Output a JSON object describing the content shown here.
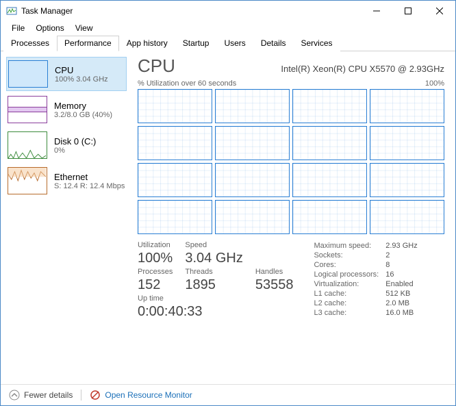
{
  "window": {
    "title": "Task Manager"
  },
  "menu": {
    "file": "File",
    "options": "Options",
    "view": "View"
  },
  "tabs": {
    "processes": "Processes",
    "performance": "Performance",
    "apphistory": "App history",
    "startup": "Startup",
    "users": "Users",
    "details": "Details",
    "services": "Services"
  },
  "sidebar": {
    "cpu": {
      "title": "CPU",
      "sub": "100%  3.04 GHz"
    },
    "memory": {
      "title": "Memory",
      "sub": "3.2/8.0 GB (40%)"
    },
    "disk": {
      "title": "Disk 0 (C:)",
      "sub": "0%"
    },
    "ethernet": {
      "title": "Ethernet",
      "sub": "S: 12.4  R: 12.4 Mbps"
    }
  },
  "main": {
    "heading": "CPU",
    "descr": "Intel(R) Xeon(R) CPU X5570 @ 2.93GHz",
    "graph_label_left": "% Utilization over 60 seconds",
    "graph_label_right": "100%",
    "labels": {
      "utilization": "Utilization",
      "speed": "Speed",
      "processes": "Processes",
      "threads": "Threads",
      "handles": "Handles",
      "uptime": "Up time"
    },
    "values": {
      "utilization": "100%",
      "speed": "3.04 GHz",
      "processes": "152",
      "threads": "1895",
      "handles": "53558",
      "uptime": "0:00:40:33"
    },
    "right_rows": [
      {
        "k": "Maximum speed:",
        "v": "2.93 GHz"
      },
      {
        "k": "Sockets:",
        "v": "2"
      },
      {
        "k": "Cores:",
        "v": "8"
      },
      {
        "k": "Logical processors:",
        "v": "16"
      },
      {
        "k": "Virtualization:",
        "v": "Enabled"
      },
      {
        "k": "L1 cache:",
        "v": "512 KB"
      },
      {
        "k": "L2 cache:",
        "v": "2.0 MB"
      },
      {
        "k": "L3 cache:",
        "v": "16.0 MB"
      }
    ]
  },
  "bottom": {
    "fewer": "Fewer details",
    "orm": "Open Resource Monitor"
  }
}
